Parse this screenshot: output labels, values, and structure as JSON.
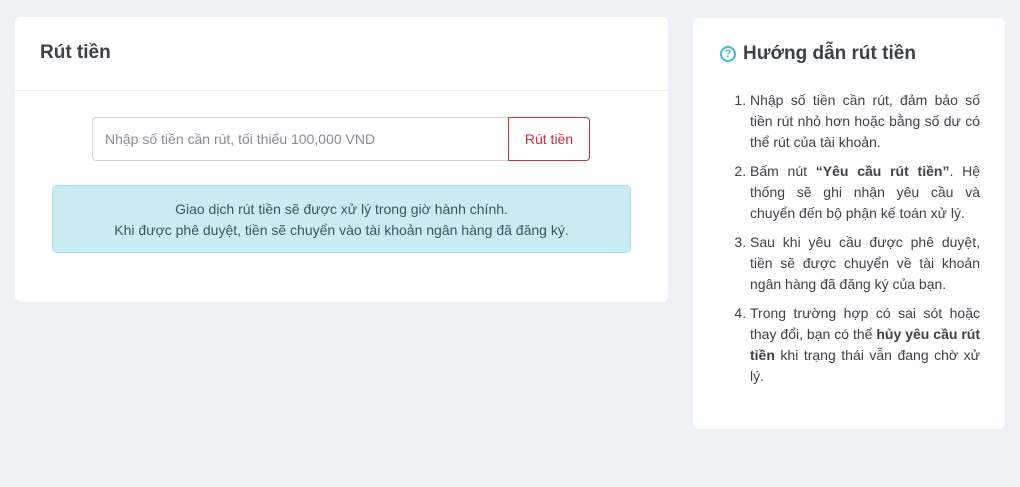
{
  "withdraw": {
    "title": "Rút tiền",
    "amount_placeholder": "Nhập số tiền cần rút, tối thiểu 100,000 VND",
    "submit_label": "Rút tiền",
    "notice_line1": "Giao dịch rút tiền sẽ được xử lý trong giờ hành chính.",
    "notice_line2": "Khi được phê duyệt, tiền sẽ chuyển vào tài khoản ngân hàng đã đăng ký."
  },
  "guide": {
    "icon": "question-circle-icon",
    "title": "Hướng dẫn rút tiền",
    "steps": [
      {
        "text": "Nhập số tiền cần rút, đảm bảo số tiền rút nhỏ hơn hoặc bằng số dư có thể rút của tài khoản."
      },
      {
        "before": "Bấm nút ",
        "bold": "“Yêu cầu rút tiền”",
        "after": ". Hệ thống sẽ ghi nhận yêu cầu và chuyển đến bộ phận kế toán xử lý."
      },
      {
        "text": "Sau khi yêu cầu được phê duyệt, tiền sẽ được chuyển về tài khoản ngân hàng đã đăng ký của bạn."
      },
      {
        "before": "Trong trường hợp có sai sót hoặc thay đổi, bạn có thể ",
        "bold": "hủy yêu cầu rút tiền",
        "after": " khi trạng thái vẫn đang chờ xử lý."
      }
    ]
  },
  "colors": {
    "background": "#edf0f5",
    "accent_red": "#d02d3c",
    "info_bg": "#c7edf2",
    "help_icon": "#3cbfcf"
  }
}
